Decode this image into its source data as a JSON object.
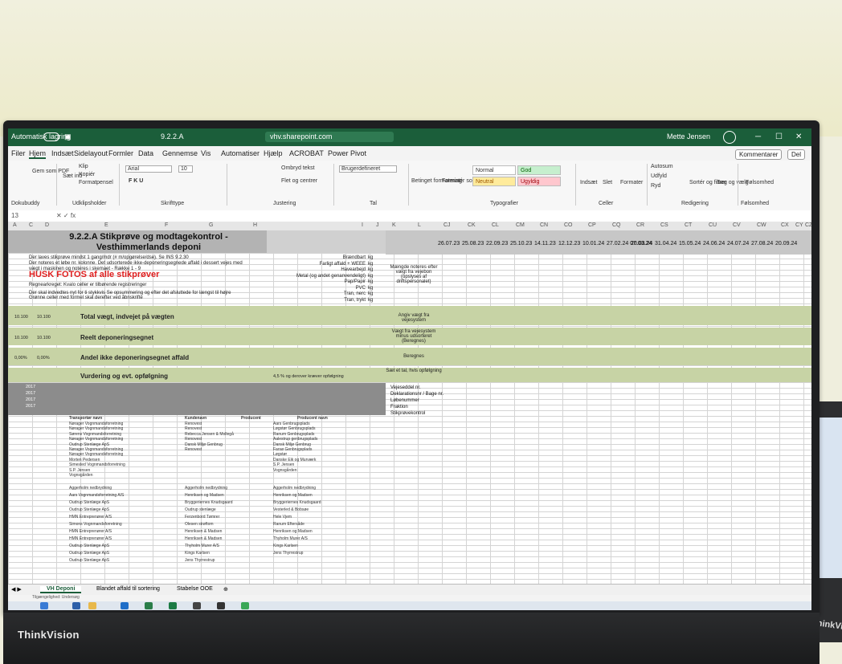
{
  "window": {
    "autosave": "Automatisk lagring",
    "filename": "9.2.2.A",
    "location": "vhv.sharepoint.com",
    "user": "Mette Jensen"
  },
  "menu": {
    "items": [
      "Filer",
      "Hjem",
      "Indsæt",
      "Sidelayout",
      "Formler",
      "Data",
      "Gennemse",
      "Vis",
      "Automatiser",
      "Hjælp",
      "ACROBAT",
      "Power Pivot"
    ],
    "comments": "Kommentarer",
    "share": "Del"
  },
  "ribbon": {
    "groups": [
      "Dokubuddy",
      "Udklipsholder",
      "Skrifttype",
      "Justering",
      "Tal",
      "Typografier",
      "Celler",
      "Redigering",
      "Følsomhed"
    ],
    "save_pdf": "Gem som PDF",
    "paste": "Sæt ind",
    "cut": "Klip",
    "copy": "Kopiér",
    "format_painter": "Formatpensel",
    "font_name": "Arial",
    "font_size": "10",
    "wrap": "Ombryd tekst",
    "merge": "Flet og centrer",
    "number_format": "Brugerdefineret",
    "cond_format": "Betinget formatering",
    "format_table": "Formatér som tabel",
    "styles": [
      "Normal",
      "God",
      "Neutral",
      "Ugyldig"
    ],
    "insert": "Indsæt",
    "delete": "Slet",
    "format": "Formater",
    "autosum": "Autosum",
    "fill": "Udfyld",
    "clear": "Ryd",
    "sort": "Sortér og filtrer",
    "find": "Søg og vælg",
    "sensitivity": "Følsomhed"
  },
  "formula_bar": {
    "cell": "13",
    "value": ""
  },
  "columns": [
    "A",
    "C",
    "D",
    "E",
    "F",
    "G",
    "H",
    "I",
    "J",
    "K",
    "L",
    "CJ",
    "CK",
    "CL",
    "CM",
    "CN",
    "CO",
    "CP",
    "CQ",
    "CR",
    "CS",
    "CT",
    "CU",
    "CV",
    "CW",
    "CX",
    "CY",
    "CZ"
  ],
  "sheet": {
    "title": "9.2.2.A Stikprøve og modtagekontrol - Vesthimmerlands deponi",
    "dates": [
      "26.07.23",
      "25.08.23",
      "22.09.23",
      "25.10.23",
      "14.11.23",
      "12.12.23",
      "10.01.24",
      "27.02.24 07.03.24",
      "20.03.24",
      "31.04.24",
      "15.05.24",
      "24.06.24",
      "24.07.24",
      "27.08.24",
      "20.09.24"
    ],
    "notes": [
      "Der laves stikprøve mindst 1 gang/mdr (# m/opgørelse/dse). Se INS 9.2.30",
      "Der noteres et løbe nr. kolonne. Det udsorterede ikke-deponeringsegnede affald i dessert vejes med",
      "vægt i maskinen og noteres i skemaet - Række 1 - 9"
    ],
    "husk": "HUSK FOTOS af alle stikprøver",
    "small_notes": [
      "Regnearkreget:    Kvalo celler er tilbørende registreringer",
      "Der skal indvedtes nyt for ti stykkvis Se opsummering og efter det afsluttede for længst til højre",
      "Grønne celler med formel skal derefter ved åbnskrifte"
    ],
    "j_labels": [
      "Brændbart",
      "Farligt affald + WEEE",
      "Havearbejd",
      "Metal (og andet genanvendeligt)",
      "Pap/Papir",
      "PVC",
      "Tran, nerc",
      "Tran, trykt"
    ],
    "units": [
      "kg",
      "kg",
      "kg",
      "kg",
      "kg",
      "kg",
      "kg",
      "kg"
    ],
    "k_note": "Mængde noteres efter vægt fra vejebon (opslyses af driftspersonalet)",
    "total_weight": "Total vægt, indvejet på vægten",
    "total_weight_vals": [
      "10.100",
      "10.100"
    ],
    "total_weight_k": "Angiv vægt fra vejesystem",
    "real_dep": "Reelt deponeringsegnet",
    "real_dep_vals": [
      "10.100",
      "10.100"
    ],
    "real_dep_k": "Vægt fra vejesystem minus udsorteret (Beregnes)",
    "share": "Andel ikke deponeringsegnet affald",
    "share_vals": [
      "0,00%",
      "0,00%"
    ],
    "share_k": "Beregnes",
    "assess": "Vurdering og evt. opfølgning",
    "assess_j": "4,5 % og derover kræver opfølgning",
    "assess_k": "Sæt et tal, hvis opfølgning",
    "row_labels": [
      "Vejeseddel nr.",
      "Deklarationsnr / Bage nr.",
      "Løbenummer",
      "Fraktion",
      "Stikprøvekontrol"
    ],
    "years": [
      "2017",
      "2017",
      "2017",
      "2017"
    ],
    "tables_hdr": [
      "Transportør navn",
      "Kundenavn",
      "Producent",
      "Producent navn"
    ],
    "carriers": [
      "Nørager Vognmandsforretning",
      "Nørager Vognmandsforretning",
      "Sørens Vognmandsforretning",
      "Nørager Vognmandsforretning",
      "Oudrup Stenlæge ApS",
      "Nørager Vognmandsforretning",
      "Nørager Vognmandsforretning",
      "Morten Pedersen",
      "Simested Vognmandsforretning",
      "S.P. Jensen",
      "Vognsgården"
    ],
    "customers": [
      "Renovest",
      "Renovest",
      "Rebecca Jensen & Mollegå",
      "Renovest",
      "Dansk Miljø Genbrug",
      "Renovest"
    ],
    "producers": [
      "Aars Genbrugsplads",
      "Løgstør Genbrugsplads",
      "Ranum Genbrugsplads",
      "Aalestrup genbrugsplads",
      "Dansk Miljø Genbrug",
      "Farsø Genbrugsplads",
      "Løgstør",
      "Danske Eik og Murværk",
      "S.P. Jensen",
      "Vognsgården"
    ],
    "more_rows": [
      "Aggerholm nedbrydning",
      "Aars Vognmandsforretning A/S",
      "Oudrup Stenlæge ApS",
      "Oudrup Stenlæge ApS",
      "HMN Entreprenører A/S",
      "Simons Vognmandsforretning",
      "HMN Entreprenører A/S",
      "HMN Entreprenører A/S",
      "Oudrup Stenlæge ApS",
      "Oudrup Stenlæge ApS",
      "Oudrup Stenlæge ApS"
    ],
    "more_customers": [
      "Aggerholm nedbrydning",
      "Henriksen og Madsen",
      "Bryggeriernes Knudsgaard",
      "Oudrup stenlæge",
      "Ferzenbord Tømrer",
      "Olesen strøftom",
      "Henriksen & Madsen",
      "Henriksen & Madsen",
      "Thyholm Murer A/S",
      "Kings Karlsen",
      "Jens Thyrrestrup"
    ],
    "more_producers": [
      "Aggerholm nedbrydning",
      "Henriksen og Madsen",
      "Bryggeriernes Knudsgaard",
      "Vesterled & Bobsøe",
      "Hele Vjem",
      "Ranum Eftersåde",
      "Henriksen og Madsen",
      "Thyholm Murer A/S",
      "Kings Karlsen",
      "Jens Thyrrestrup"
    ]
  },
  "sheet_tabs": [
    "VH Deponi",
    "Blandet affald til sortering",
    "Stabelse OOE"
  ],
  "status": "Tilgængelighed: Undersøg",
  "monitor_brand": "ThinkVision",
  "side_brand": "ThinkVi"
}
